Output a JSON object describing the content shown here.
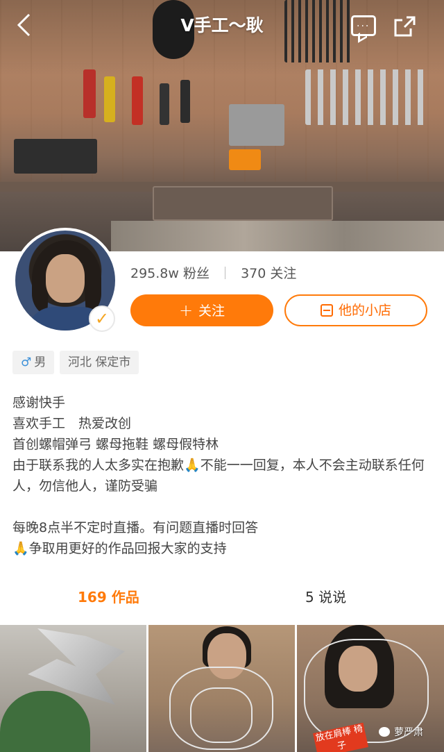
{
  "header": {
    "title": "V手工～耿",
    "back_icon": "chevron-left-icon",
    "message_icon": "chat-bubble-icon",
    "share_icon": "share-icon"
  },
  "profile": {
    "followers": "295.8w 粉丝",
    "following": "370 关注",
    "follow_label": "关注",
    "shop_label": "他的小店",
    "gender_symbol": "♂",
    "gender": "男",
    "location": "河北 保定市"
  },
  "bio": {
    "line1": "感谢快手",
    "line2": "喜欢手工　热爱改创",
    "line3": "首创螺帽弹弓  螺母拖鞋  螺母假特林",
    "line4_prefix": "由于联系我的人太多实在抱歉",
    "line4_suffix": "不能一一回复，本人不会主动联系任何人，勿信他人，谨防受骗",
    "line5": "每晚8点半不定时直播。有问题直播时回答",
    "line6": "争取用更好的作品回报大家的支持",
    "emoji": "🙏"
  },
  "tabs": {
    "works": "169 作品",
    "says": "5 说说"
  },
  "thumbnails": {
    "sticker_text": "放在肩棒 椅子"
  },
  "watermark": "萝严肃",
  "colors": {
    "accent": "#ff7a0a",
    "male_blue": "#3a8fd8"
  }
}
